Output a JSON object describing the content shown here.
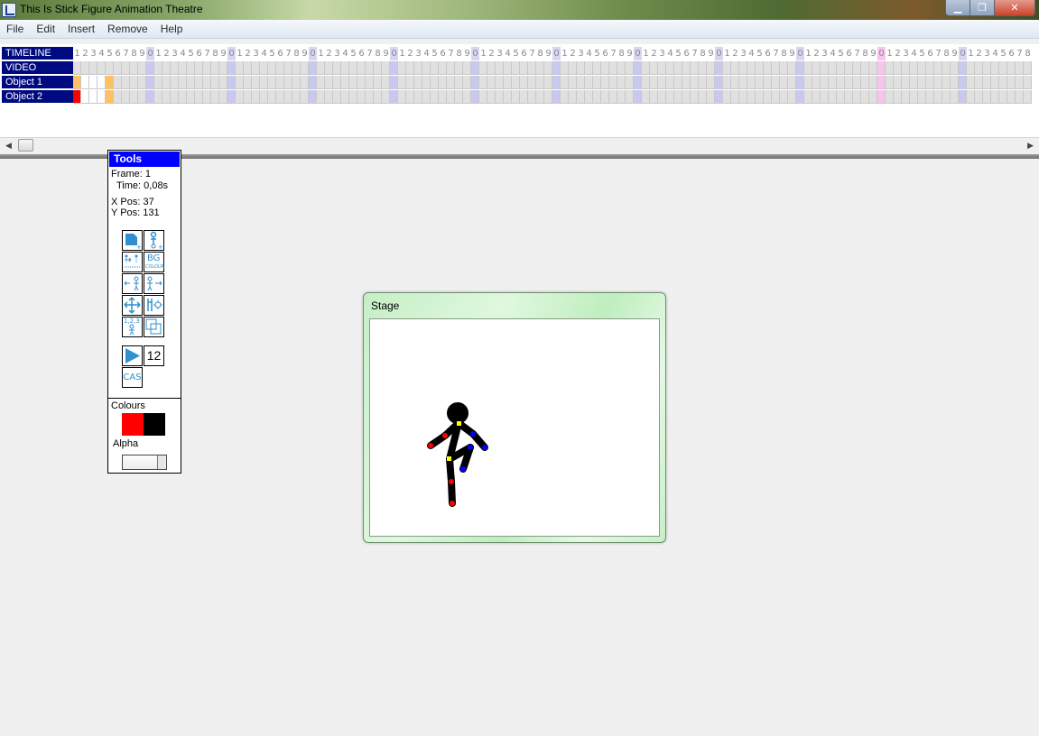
{
  "window": {
    "title": "This Is Stick Figure Animation Theatre",
    "min_label": "▁",
    "max_label": "❐",
    "close_label": "✕"
  },
  "menu": [
    "File",
    "Edit",
    "Insert",
    "Remove",
    "Help"
  ],
  "timeline": {
    "rows": [
      "TIMELINE",
      "VIDEO",
      "Object 1",
      "Object 2"
    ],
    "frame_digits": "1234567890"
  },
  "tools": {
    "title": "Tools",
    "frame_label": "Frame: 1",
    "time_label": "Time: 0,08s",
    "xpos_label": "X Pos: 37",
    "ypos_label": "Y Pos: 131",
    "speed_value": "12",
    "cas_label": "CAS",
    "bg_label": "BG",
    "colours_label": "Colours",
    "alpha_label": "Alpha",
    "colour_1": "#ff0000",
    "colour_2": "#000000",
    "icons": [
      "add-frame-icon",
      "add-stick-icon",
      "onion-skin-icon",
      "bg-colour-icon",
      "flip-horizontal-icon",
      "flip-figure-icon",
      "move-icon",
      "edit-figure-icon",
      "numbered-frames-icon",
      "copy-frame-icon",
      "play-icon",
      "cas-icon"
    ]
  },
  "stage": {
    "title": "Stage"
  }
}
